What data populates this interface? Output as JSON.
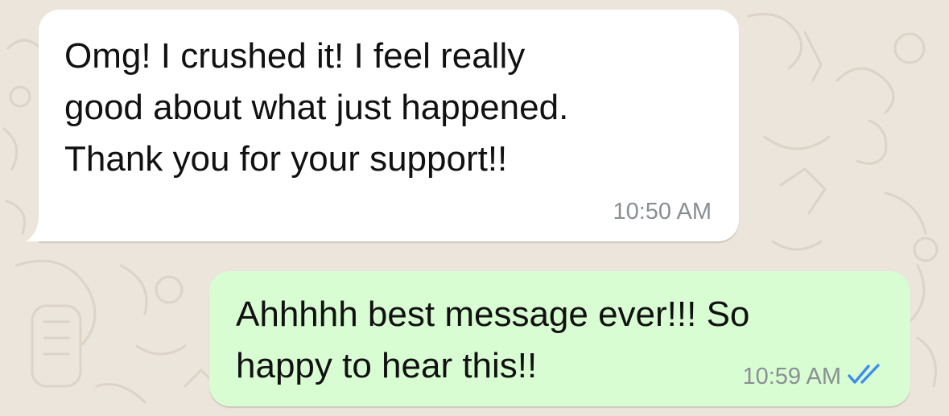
{
  "chat": {
    "wallpaper_icon": "doodle-pattern",
    "messages": [
      {
        "direction": "incoming",
        "text": "Omg!  I crushed it!  I feel really\ngood about what just happened.\nThank you for your support!!",
        "time": "10:50 AM"
      },
      {
        "direction": "outgoing",
        "text": "Ahhhhh best message ever!!!  So\nhappy to hear this!!",
        "time": "10:59 AM",
        "status_icon": "double-check-read-icon"
      }
    ]
  },
  "colors": {
    "background": "#ece5dc",
    "incoming_bubble": "#ffffff",
    "outgoing_bubble": "#d9fdd3",
    "read_ticks": "#3b8df0",
    "timestamp": "#8a8f93"
  }
}
